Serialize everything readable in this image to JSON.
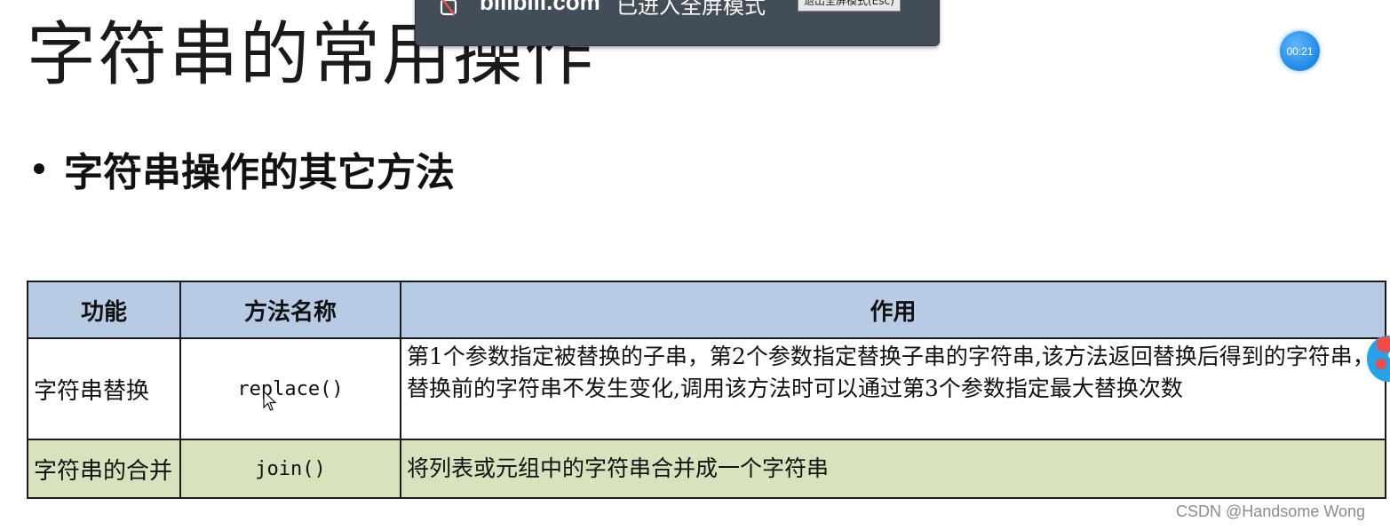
{
  "slide": {
    "title": "字符串的常用操作",
    "bullet": "字符串操作的其它方法"
  },
  "fullscreen_notice": {
    "site": "bilibili.com",
    "message": "已进入全屏模式",
    "exit_button": "退出全屏模式(Esc)",
    "icon": "no-popup-icon"
  },
  "timer": {
    "value": "00:21"
  },
  "table": {
    "headers": [
      "功能",
      "方法名称",
      "作用"
    ],
    "rows": [
      {
        "function": "字符串替换",
        "method": "replace()",
        "description": "第1个参数指定被替换的子串，第2个参数指定替换子串的字符串,该方法返回替换后得到的字符串，替换前的字符串不发生变化,调用该方法时可以通过第3个参数指定最大替换次数"
      },
      {
        "function": "字符串的合并",
        "method": "join()",
        "description": "将列表或元组中的字符串合并成一个字符串"
      }
    ]
  },
  "watermark": "CSDN @Handsome  Wong",
  "colors": {
    "header_bg": "#b7cce4",
    "join_row_bg": "#d7e3bc",
    "notice_bg": "#424d57",
    "timer_bg": "#1e88e5"
  }
}
